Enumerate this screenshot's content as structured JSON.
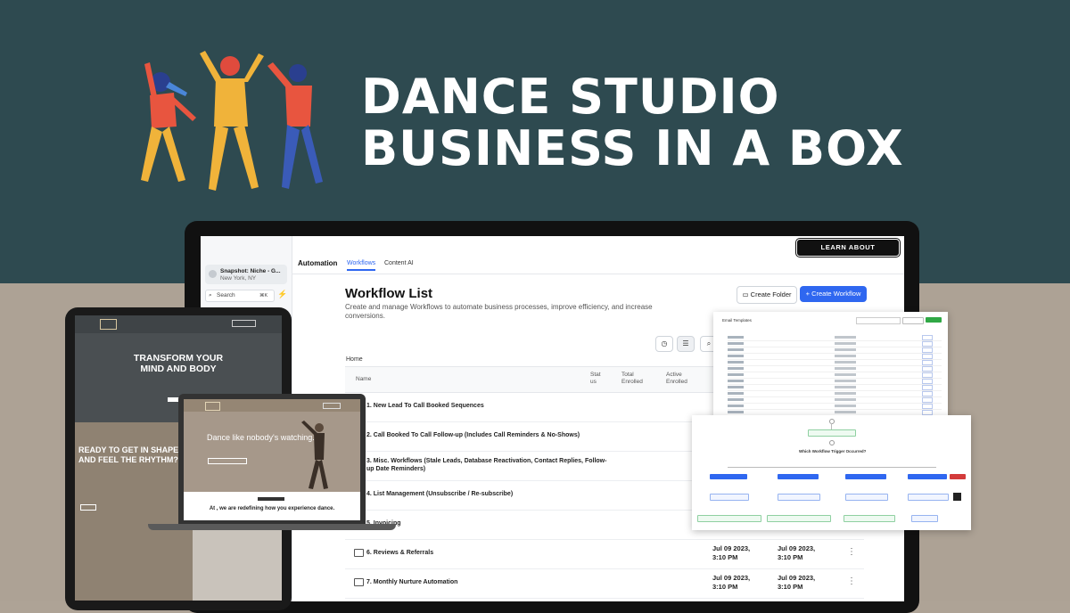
{
  "hero": {
    "line1": "DANCE STUDIO",
    "line2": "BUSINESS IN A BOX"
  },
  "colors": {
    "top_band": "#2e4a50",
    "bottom_band": "#ada295",
    "accent_blue": "#2f67f0"
  },
  "app": {
    "sidebar": {
      "snapshot_title": "Snapshot: Niche - G...",
      "snapshot_location": "New York, NY",
      "search_placeholder": "Search",
      "search_shortcut": "⌘K"
    },
    "topbar": {
      "learn_button": "LEARN ABOUT WORKFLOWS",
      "help_label": "?"
    },
    "nav": {
      "section": "Automation",
      "tabs": [
        {
          "label": "Workflows",
          "active": true
        },
        {
          "label": "Content AI",
          "active": false
        }
      ]
    },
    "page": {
      "title": "Workflow List",
      "description": "Create and manage Workflows to automate business processes, improve efficiency, and increase conversions.",
      "create_folder": "Create Folder",
      "create_workflow": "Create Workflow",
      "breadcrumb": "Home"
    },
    "table": {
      "columns": {
        "name": "Name",
        "status_a": "Stat",
        "status_b": "us",
        "total_a": "Total",
        "total_b": "Enrolled",
        "active_a": "Active",
        "active_b": "Enrolled"
      },
      "rows": [
        {
          "name": "1. New Lead To Call Booked Sequences",
          "date": "",
          "time": ""
        },
        {
          "name": "2. Call Booked To Call Follow-up (Includes Call Reminders & No-Shows)",
          "date": "",
          "time": ""
        },
        {
          "name": "3. Misc. Workflows (Stale Leads, Database Reactivation, Contact Replies, Follow-up Date Reminders)",
          "date": "",
          "time": ""
        },
        {
          "name": "4. List Management (Unsubscribe / Re-subscribe)",
          "date": "",
          "time": ""
        },
        {
          "name": "5. Invoicing",
          "date": "",
          "time": ""
        },
        {
          "name": "6. Reviews & Referrals",
          "date": "Jul 09 2023,",
          "time": "3:10 PM"
        },
        {
          "name": "7. Monthly Nurture Automation",
          "date": "Jul 09 2023,",
          "time": "3:10 PM"
        }
      ]
    }
  },
  "panels": {
    "email_title": "Email Templates",
    "trigger_label": "Which Workflow Trigger Occurred?"
  },
  "tablet": {
    "hero_line1": "TRANSFORM YOUR",
    "hero_line2": "MIND AND BODY",
    "ready_line1": "READY TO GET IN SHAPE",
    "ready_line2": "AND FEEL THE RHYTHM?"
  },
  "laptop": {
    "headline": "Dance like nobody's watching.",
    "subline": "At , we are redefining how you experience dance."
  }
}
